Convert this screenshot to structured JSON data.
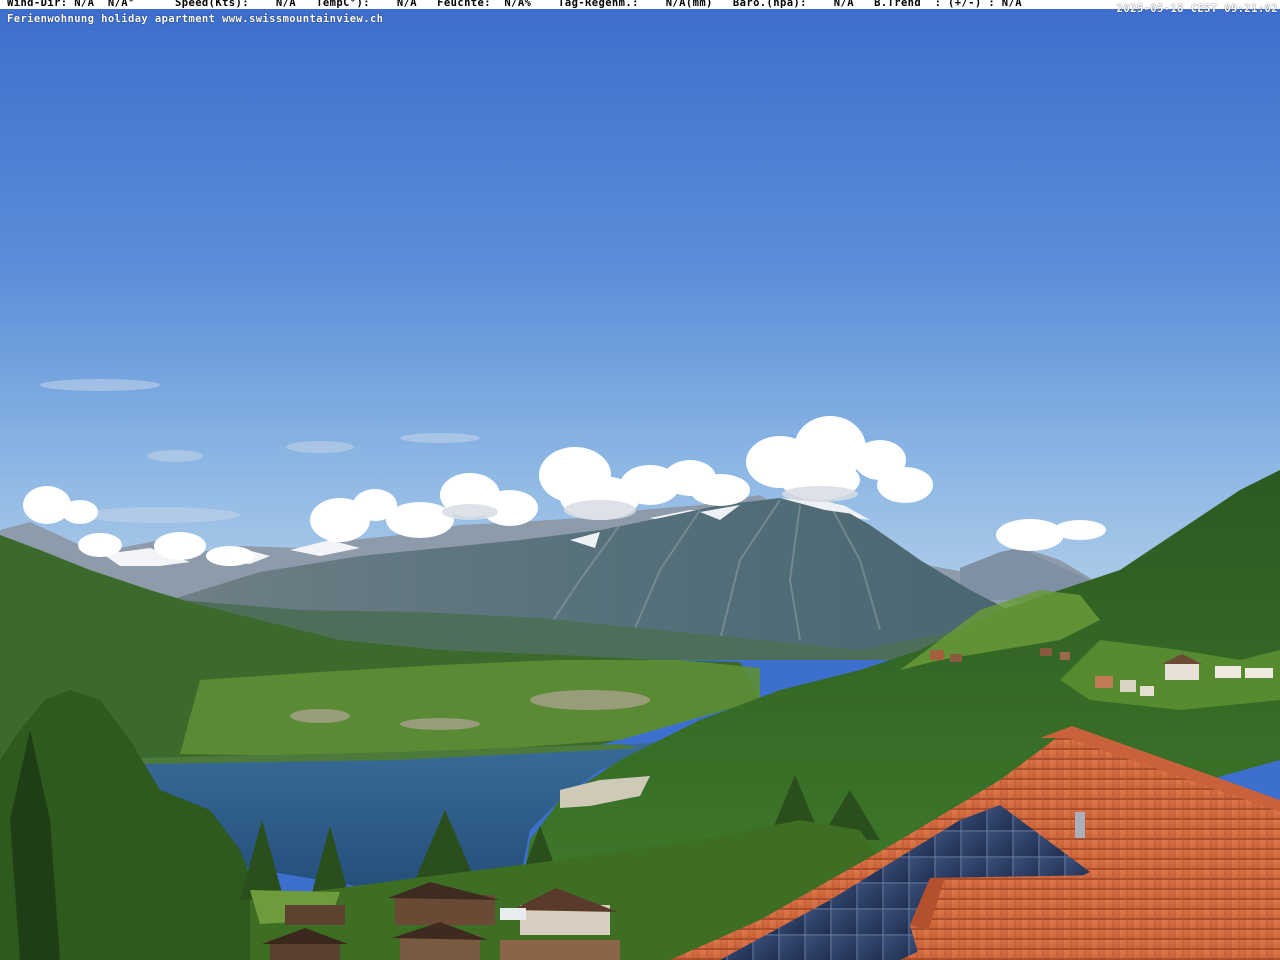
{
  "overlay": {
    "weather_line": "Wind-Dir: N/A  N/A°      Speed(Kts):    N/A   TempC°):    N/A   Feuchte:  N/A%    Tag-Regenm.:    N/A(mm)   Baro.(hpa):    N/A   B.Trend  : (+/-) : N/A",
    "caption": "Ferienwohnung holiday apartment www.swissmountainview.ch",
    "timestamp": "2025-05-18 CEST 09:21:02"
  },
  "scene": {
    "subjects": [
      "blue-sky",
      "cumulus-clouds",
      "snow-capped-alps",
      "niesen-pyramid-mountain",
      "lake-thun",
      "forested-slopes",
      "village",
      "chalets",
      "terracotta-roof",
      "solar-panels"
    ],
    "colors": {
      "sky_top": "#3c6dcd",
      "sky_bottom": "#8cb7e4",
      "lake": "#2e5f8e",
      "roof": "#d5693f",
      "forest": "#2f5a22",
      "meadow": "#5d8f35"
    }
  }
}
